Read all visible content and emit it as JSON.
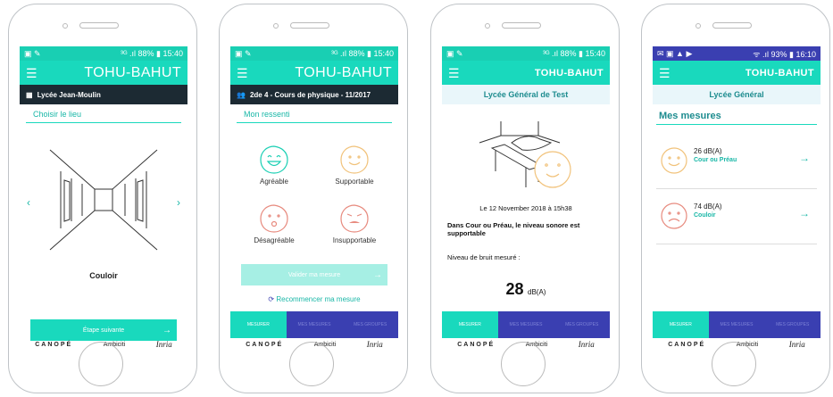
{
  "app": {
    "brand": "TOHU-BAHUT",
    "menu_icon": "☰"
  },
  "screens": [
    {
      "status": {
        "left": "▣ ✎",
        "right": "³ᴳ .ıl 88% ▮ 15:40"
      },
      "school": "Lycée Jean-Moulin",
      "section": "Choisir le lieu",
      "place": "Couloir",
      "next": "Étape suivante"
    },
    {
      "status": {
        "left": "▣ ✎",
        "right": "³ᴳ .ıl 88% ▮ 15:40"
      },
      "class_title": "2de 4 - Cours de physique - 11/2017",
      "section": "Mon ressenti",
      "feelings": [
        "Agréable",
        "Supportable",
        "Désagréable",
        "Insupportable"
      ],
      "validate": "Valider ma mesure",
      "restart": "Recommencer ma mesure",
      "tabs": [
        "MESURER",
        "MES MESURES",
        "MES GROUPES"
      ]
    },
    {
      "status": {
        "left": "▣ ✎",
        "right": "³ᴳ .ıl 88% ▮ 15:40"
      },
      "school": "Lycée Général de Test",
      "date": "Le 12 November 2018 à 15h38",
      "verdict": "Dans Cour ou Préau, le niveau sonore est supportable",
      "noise_label": "Niveau de bruit mesuré :",
      "noise_value": "28",
      "noise_unit": "dB(A)",
      "tabs": [
        "MESURER",
        "MES MESURES",
        "MES GROUPES"
      ]
    },
    {
      "status": {
        "left": "✉ ▣ ▲ ▶",
        "right": "ᯤ .ıl 93% ▮ 16:10"
      },
      "school": "Lycée Général",
      "section": "Mes mesures",
      "measures": [
        {
          "value": "26 dB(A)",
          "place": "Cour ou Préau"
        },
        {
          "value": "74 dB(A)",
          "place": "Couloir"
        }
      ],
      "tabs": [
        "MESURER",
        "MES MESURES",
        "MES GROUPES"
      ]
    }
  ],
  "logos": {
    "canope": "CANOPÉ",
    "ambiciti": "Ambiciti",
    "inria": "Inria"
  },
  "colors": {
    "teal": "#19d9bd",
    "dark": "#1c2a33",
    "indigo": "#3a3fb1",
    "happy": "#f1c27a",
    "sad": "#e78a7e"
  }
}
